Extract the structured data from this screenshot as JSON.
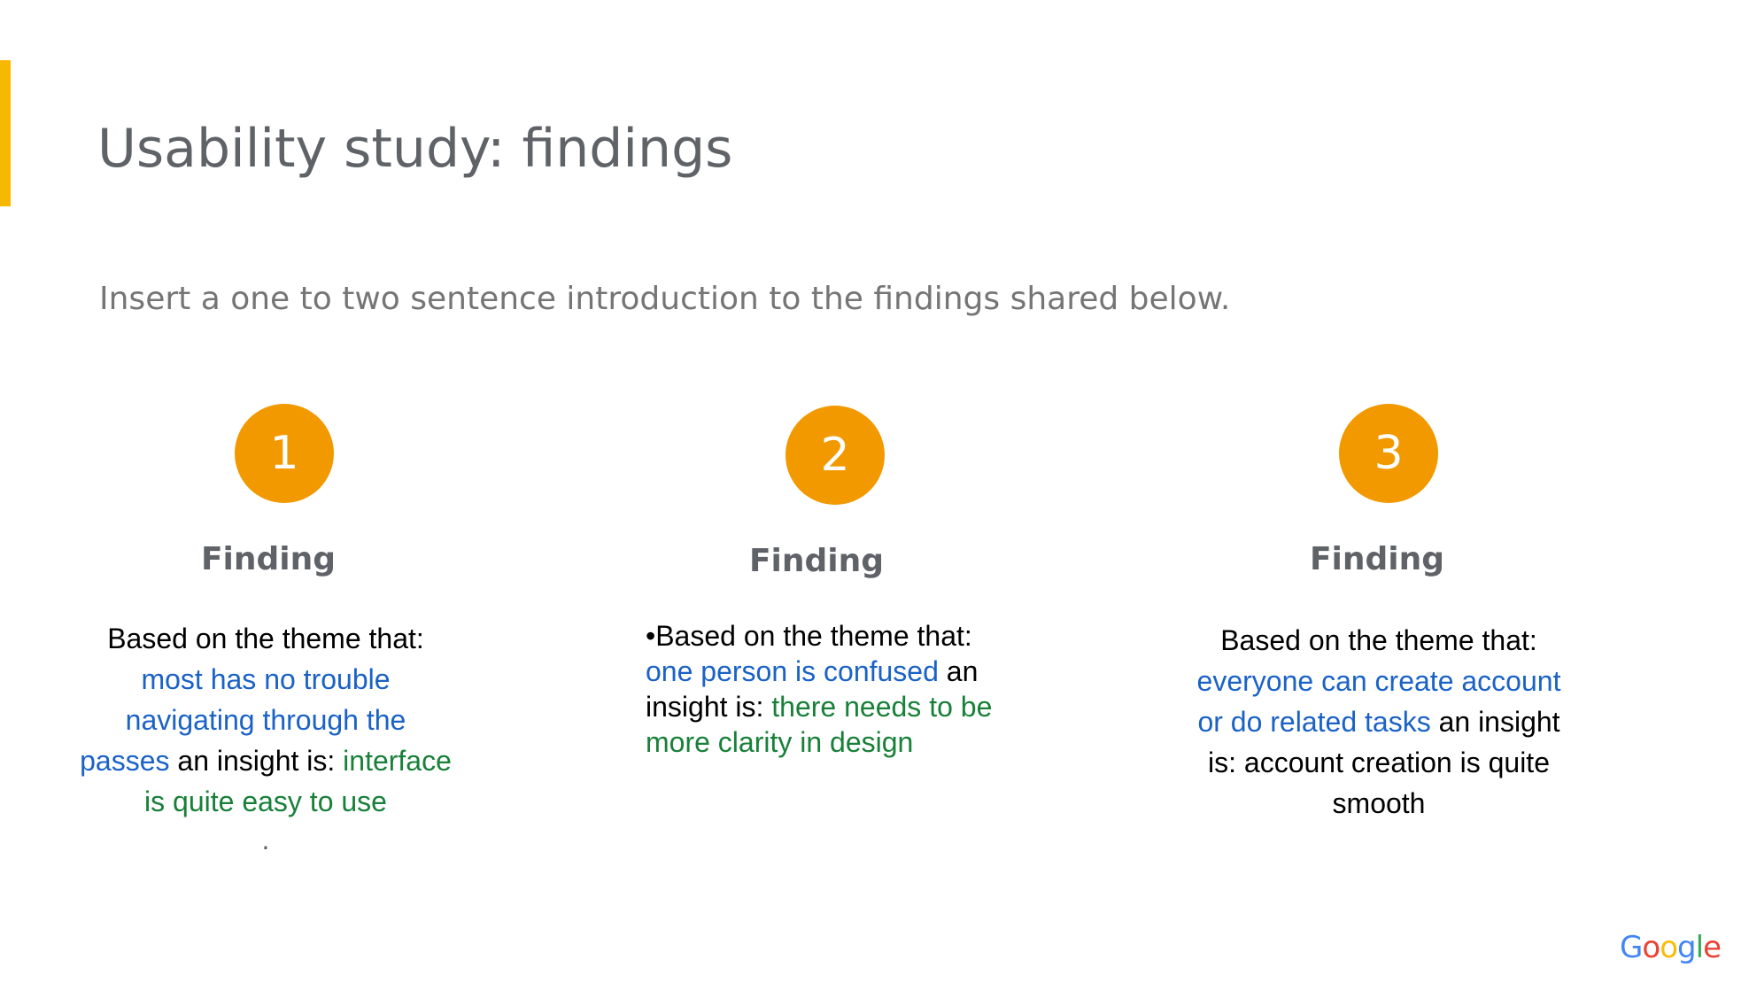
{
  "slide": {
    "title": "Usability study: findings",
    "intro": "Insert a one to two sentence introduction to the findings shared below.",
    "colors": {
      "accent_bar": "#f6b800",
      "number_circle": "#f29900",
      "theme_text": "#1a62c6",
      "insight_text": "#188038"
    }
  },
  "findings": [
    {
      "number": "1",
      "heading": "Finding",
      "prefix": "Based on the theme that:",
      "theme": "most has no trouble navigating through the passes",
      "connector": "an insight is:",
      "insight": "interface is quite easy to use",
      "trailing": "."
    },
    {
      "number": "2",
      "heading": "Finding",
      "prefix": "•Based on the theme that:",
      "theme": "one person is confused",
      "connector": "an insight is:",
      "insight": "there needs to be more clarity in design"
    },
    {
      "number": "3",
      "heading": "Finding",
      "prefix": "Based on the theme that:",
      "theme": "everyone can create account or do related tasks",
      "connector": "an insight is: account creation is quite smooth"
    }
  ],
  "footer": {
    "logo": {
      "text": "Google",
      "letters": [
        "G",
        "o",
        "o",
        "g",
        "l",
        "e"
      ]
    }
  }
}
